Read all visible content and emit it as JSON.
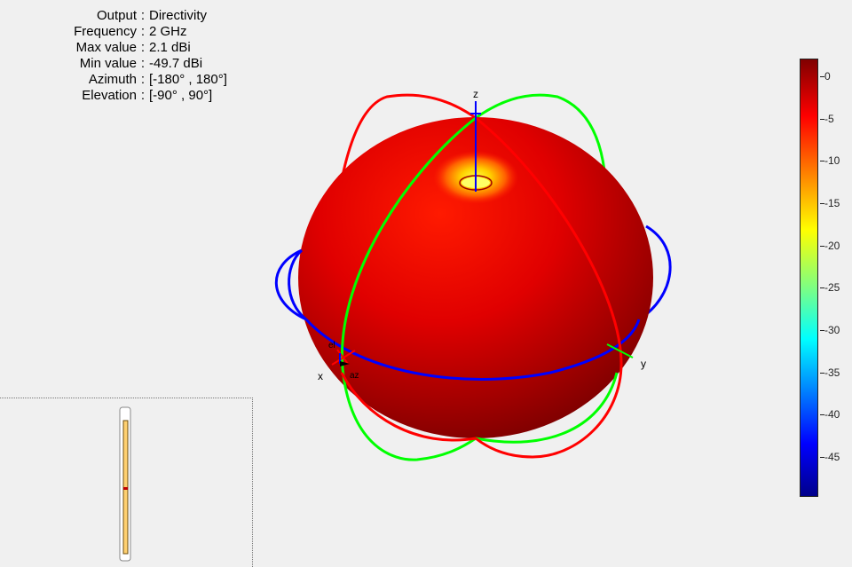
{
  "info": {
    "rows": [
      {
        "label": "Output",
        "value": "Directivity"
      },
      {
        "label": "Frequency",
        "value": "2 GHz"
      },
      {
        "label": "Max value",
        "value": "2.1 dBi"
      },
      {
        "label": "Min value",
        "value": "-49.7 dBi"
      },
      {
        "label": "Azimuth",
        "value": "[-180° , 180°]"
      },
      {
        "label": "Elevation",
        "value": "[-90° , 90°]"
      }
    ],
    "separator": ":"
  },
  "axes": {
    "x": "x",
    "y": "y",
    "z": "z",
    "el": "el",
    "az": "az"
  },
  "chart_data": {
    "type": "3d-radiation-pattern",
    "quantity": "Directivity",
    "frequency_ghz": 2,
    "max_dbi": 2.1,
    "min_dbi": -49.7,
    "azimuth_range_deg": [
      -180,
      180
    ],
    "elevation_range_deg": [
      -90,
      90
    ],
    "colorbar": {
      "ticks": [
        0,
        -5,
        -10,
        -15,
        -20,
        -25,
        -30,
        -35,
        -40,
        -45
      ],
      "range": [
        -49.7,
        2.1
      ],
      "colormap": [
        "#800000",
        "#ff0000",
        "#ff8000",
        "#ffff00",
        "#80ff80",
        "#00ffff",
        "#0080ff",
        "#0000ff",
        "#00008a"
      ]
    },
    "overlay_colors": {
      "azimuth_cut": "#0000ff",
      "elevation_cut_x": "#00ff00",
      "elevation_cut_y": "#ff0000",
      "z_axis": "#0000ff"
    }
  }
}
